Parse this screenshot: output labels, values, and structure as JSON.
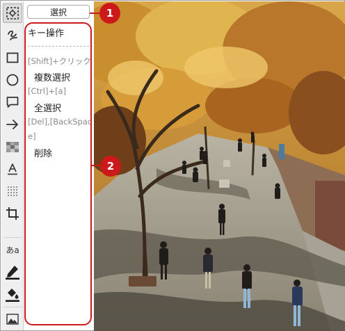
{
  "toolbar": {
    "tools": [
      {
        "name": "select-tool-icon",
        "icon": "dotted-square-crosshair"
      },
      {
        "name": "freehand-tool-icon",
        "icon": "squiggle"
      },
      {
        "name": "rectangle-tool-icon",
        "icon": "rectangle"
      },
      {
        "name": "ellipse-tool-icon",
        "icon": "circle"
      },
      {
        "name": "speech-bubble-tool-icon",
        "icon": "speech-bubble"
      },
      {
        "name": "arrow-tool-icon",
        "icon": "arrow-right"
      },
      {
        "name": "mosaic-tool-icon",
        "icon": "mosaic"
      },
      {
        "name": "text-tool-icon",
        "icon": "underlined-a"
      },
      {
        "name": "blur-tool-icon",
        "icon": "dot-grid"
      },
      {
        "name": "crop-tool-icon",
        "icon": "crop"
      },
      {
        "name": "font-tool-icon",
        "icon": "font-sample"
      },
      {
        "name": "line-color-icon",
        "icon": "pen"
      },
      {
        "name": "fill-color-icon",
        "icon": "paint-bucket"
      },
      {
        "name": "image-tool-icon",
        "icon": "landscape"
      }
    ],
    "font_label": "あa"
  },
  "select_button_label": "選択",
  "key_panel": {
    "title": "キー操作",
    "shift_key": "[Shift]+クリック",
    "shift_action": "複数選択",
    "ctrl_key": "[Ctrl]+[a]",
    "ctrl_action": "全選択",
    "delete_key_line1": "[Del],[BackSpac",
    "delete_key_line2": "e]",
    "delete_action": "削除"
  },
  "callouts": {
    "badge_1": "1",
    "badge_2": "2",
    "color": "#cc1a1a"
  },
  "colors": {
    "accent": "#cc1a1a",
    "toolbar_bg": "#efefef"
  }
}
